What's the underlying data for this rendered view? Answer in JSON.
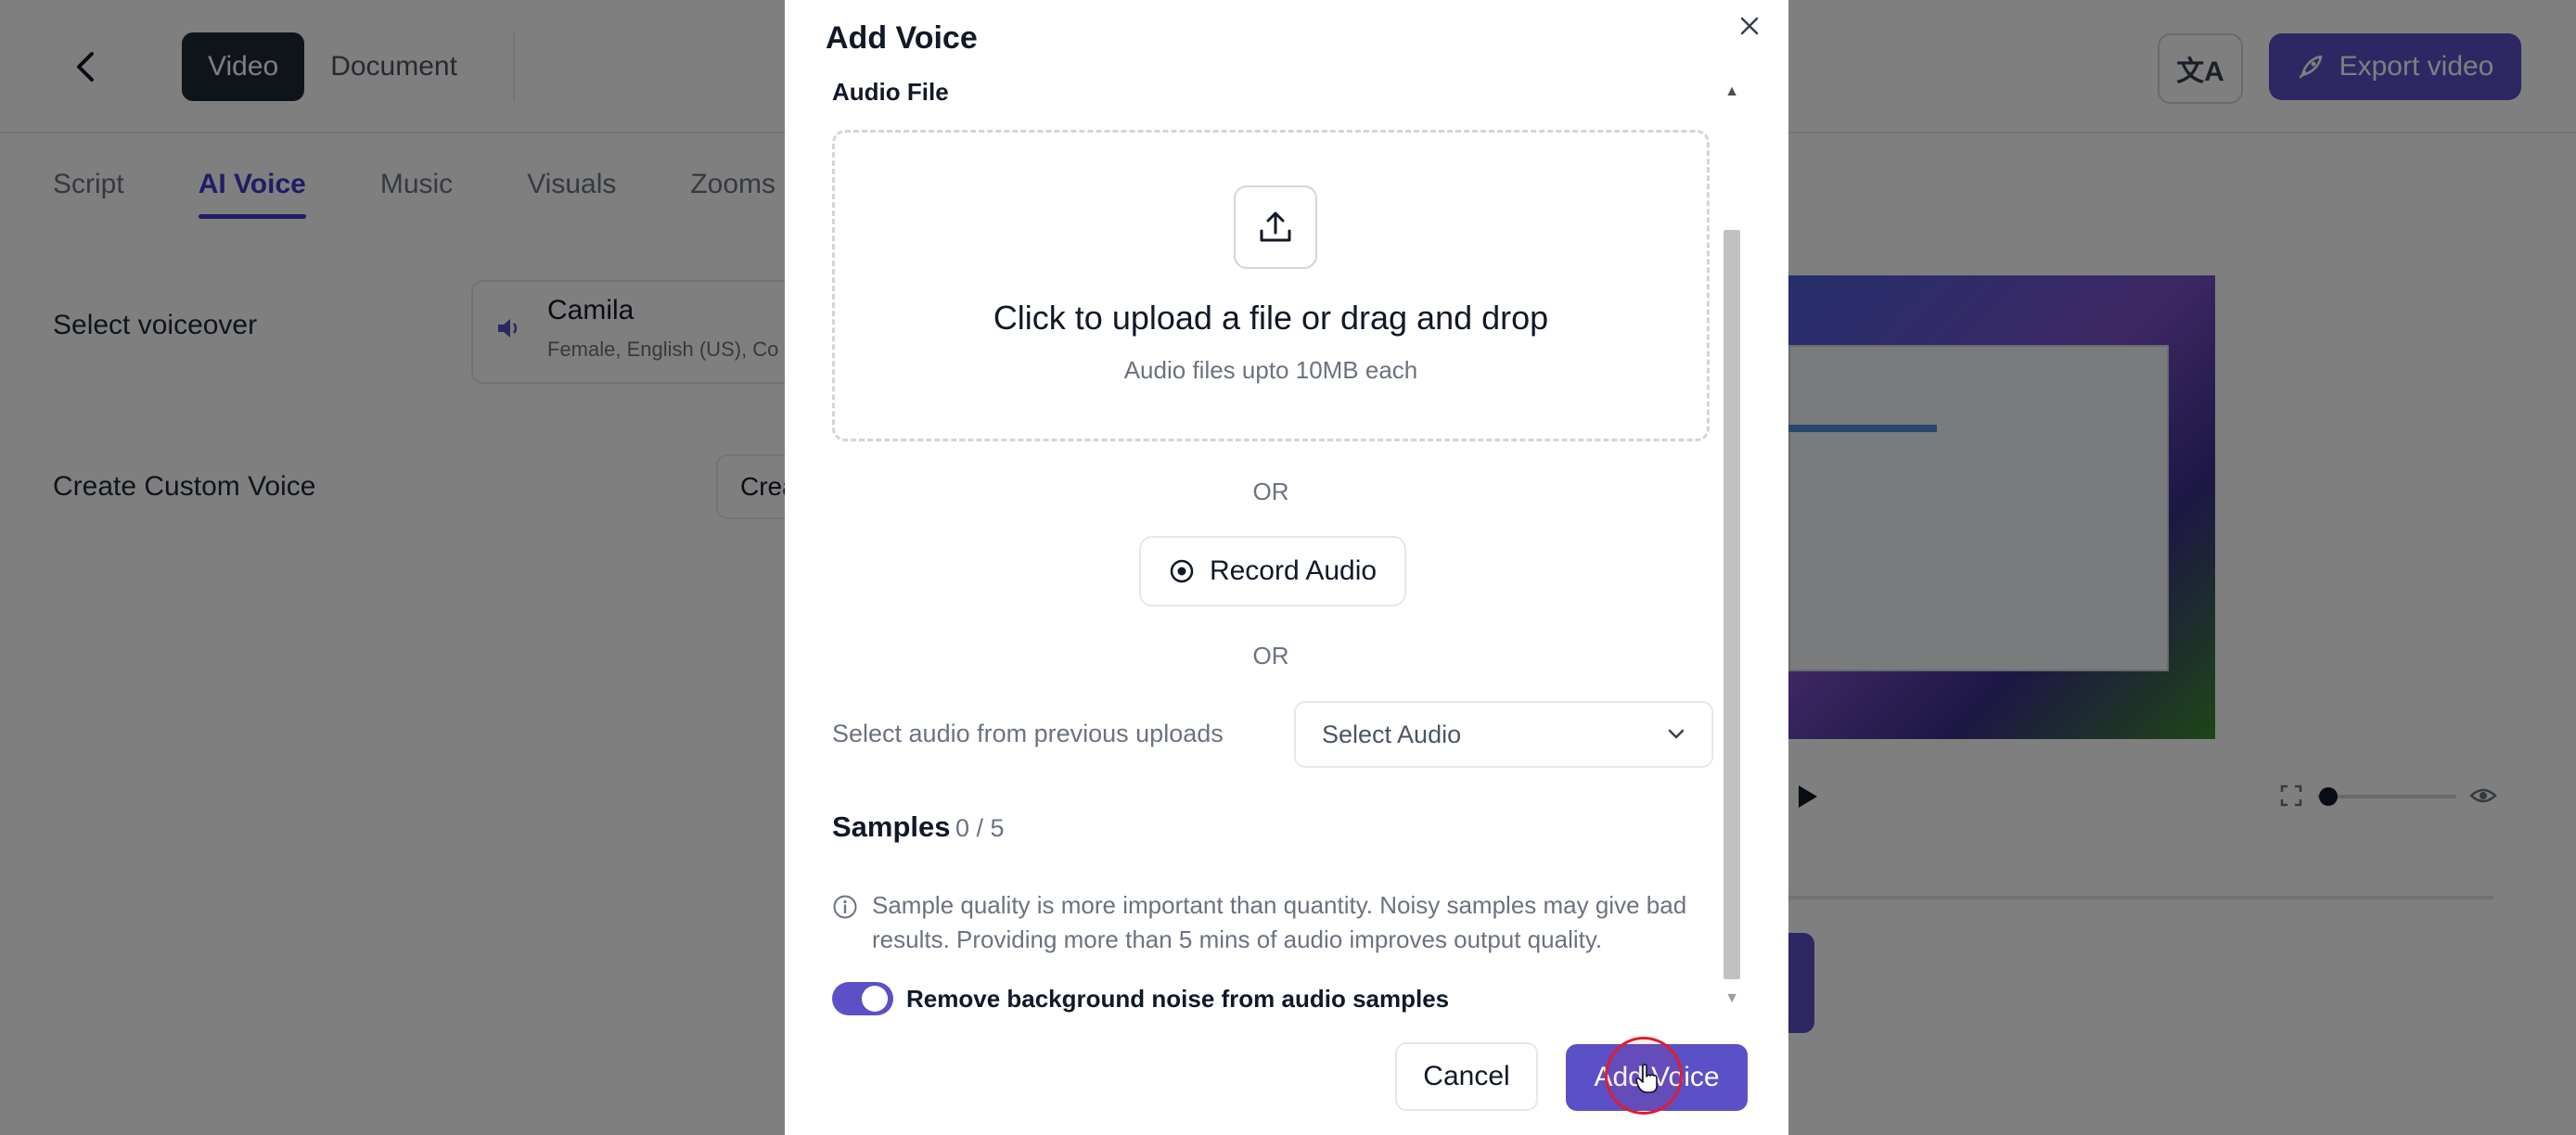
{
  "header": {
    "segments": [
      {
        "label": "Video",
        "active": true
      },
      {
        "label": "Document",
        "active": false
      }
    ],
    "export_label": "Export video"
  },
  "tabs": [
    {
      "label": "Script",
      "active": false
    },
    {
      "label": "AI Voice",
      "active": true
    },
    {
      "label": "Music",
      "active": false
    },
    {
      "label": "Visuals",
      "active": false
    },
    {
      "label": "Zooms",
      "active": false
    }
  ],
  "settings": {
    "voiceover_label": "Select voiceover",
    "voice_name": "Camila",
    "voice_desc": "Female, English (US), Co",
    "custom_voice_label": "Create Custom Voice",
    "create_button_partial": "Crea"
  },
  "modal": {
    "title": "Add Voice",
    "audio_file_label": "Audio File",
    "upload_title": "Click to upload a file or drag and drop",
    "upload_sub": "Audio files upto 10MB each",
    "or_label": "OR",
    "record_label": "Record Audio",
    "prev_uploads_label": "Select audio from previous uploads",
    "select_audio_label": "Select Audio",
    "samples_title": "Samples",
    "samples_count": "0 / 5",
    "info_text": "Sample quality is more important than quantity. Noisy samples may give bad results. Providing more than 5 mins of audio improves output quality.",
    "noise_label": "Remove background noise from audio samples",
    "noise_enabled": true,
    "cancel_label": "Cancel",
    "add_voice_label": "Add Voice"
  },
  "colors": {
    "accent": "#5b50c7",
    "tab_active": "#4338ca",
    "click_marker": "#e11d2e"
  },
  "icons": [
    "back-chevron-icon",
    "translate-icon",
    "rocket-icon",
    "speaker-icon",
    "close-icon",
    "upload-icon",
    "record-icon",
    "chevron-down-icon",
    "info-icon",
    "pointer-hand-icon"
  ]
}
